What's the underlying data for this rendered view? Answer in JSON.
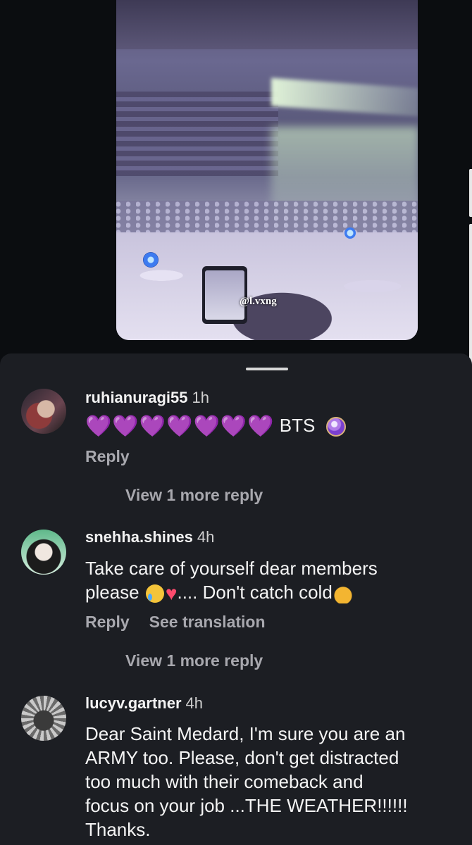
{
  "video": {
    "watermark": "@l.vxng"
  },
  "comments": [
    {
      "username": "ruhianuragi55",
      "time": "1h",
      "hearts": [
        "💜",
        "💜",
        "💜",
        "💜",
        "💜",
        "💜",
        "💜"
      ],
      "text_suffix": "BTS",
      "actions": {
        "reply": "Reply"
      },
      "view_more": "View 1 more reply"
    },
    {
      "username": "snehha.shines",
      "time": "4h",
      "line1": "Take care of yourself dear members",
      "line2_a": "please",
      "line2_b": ".... Don't catch cold",
      "actions": {
        "reply": "Reply",
        "translate": "See translation"
      },
      "view_more": "View 1 more reply"
    },
    {
      "username": "lucyv.gartner",
      "time": "4h",
      "lines": [
        "Dear Saint Medard, I'm sure you are an",
        "ARMY too. Please, don't get distracted",
        "too much with their comeback and",
        "focus on your job ...THE WEATHER!!!!!!",
        "Thanks."
      ]
    }
  ],
  "icons": [
    "crystal-ball-icon",
    "crying-face-icon",
    "red-heart-icon",
    "raised-hands-icon",
    "purple-heart-icon"
  ]
}
